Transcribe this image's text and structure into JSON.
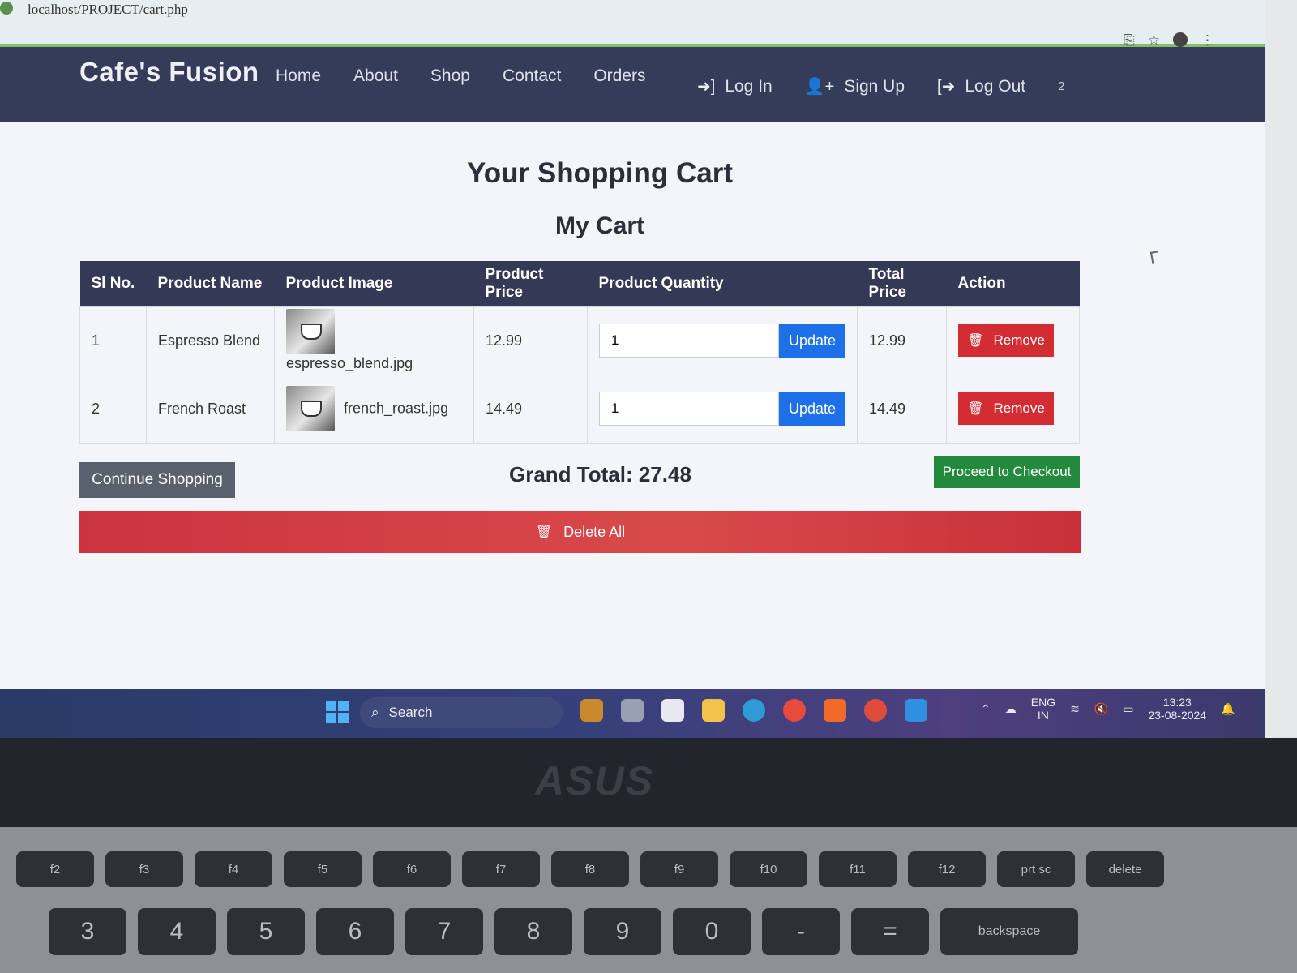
{
  "browser": {
    "url": "localhost/PROJECT/cart.php"
  },
  "navbar": {
    "brand": "Cafe's Fusion",
    "links": [
      "Home",
      "About",
      "Shop",
      "Contact",
      "Orders"
    ],
    "login_label": "Log In",
    "signup_label": "Sign Up",
    "logout_label": "Log Out",
    "cart_count": "2"
  },
  "page": {
    "title": "Your Shopping Cart",
    "subtitle": "My Cart"
  },
  "table": {
    "headers": [
      "Sl No.",
      "Product Name",
      "Product Image",
      "Product Price",
      "Product Quantity",
      "Total Price",
      "Action"
    ],
    "rows": [
      {
        "sl": "1",
        "name": "Espresso Blend",
        "image": "espresso_blend.jpg",
        "price": "12.99",
        "quantity": "1",
        "total": "12.99"
      },
      {
        "sl": "2",
        "name": "French Roast",
        "image": "french_roast.jpg",
        "price": "14.49",
        "quantity": "1",
        "total": "14.49"
      }
    ],
    "update_label": "Update",
    "remove_label": "Remove"
  },
  "footer": {
    "continue_label": "Continue Shopping",
    "grand_total": "Grand Total: 27.48",
    "checkout_label": "Proceed to Checkout",
    "delete_all_label": "Delete All"
  },
  "taskbar": {
    "search_label": "Search",
    "lang_top": "ENG",
    "lang_bottom": "IN",
    "time": "13:23",
    "date": "23-08-2024"
  },
  "laptop": {
    "brand": "ASUS",
    "keys_top": [
      "f2",
      "f3",
      "f4",
      "f5",
      "f6",
      "f7",
      "f8",
      "f9",
      "f10",
      "f11",
      "f12",
      "prt sc",
      "delete"
    ],
    "keys_bottom": [
      "3",
      "4",
      "5",
      "6",
      "7",
      "8",
      "9",
      "0",
      "-",
      "=",
      "backspace"
    ]
  },
  "colors": {
    "navbar": "#353c5a",
    "update": "#1e70e8",
    "remove": "#d22d33",
    "checkout": "#238a3d",
    "continue": "#59616d"
  }
}
